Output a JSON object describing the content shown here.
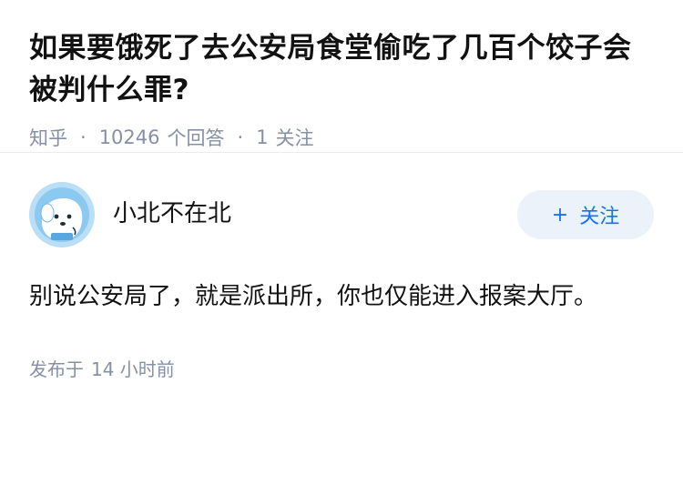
{
  "question": {
    "title": "如果要饿死了去公安局食堂偷吃了几百个饺子会被判什么罪?",
    "source": "知乎",
    "answer_count": "10246",
    "answer_label": "个回答",
    "follower_count": "1",
    "follower_label": "关注"
  },
  "answer": {
    "author_name": "小北不在北",
    "follow_button": {
      "plus": "+",
      "label": "关注"
    },
    "content": "别说公安局了，就是派出所，你也仅能进入报案大厅。",
    "published_label": "发布于",
    "published_time": "14 小时前"
  },
  "colors": {
    "accent": "#1772f6",
    "follow_bg": "#ebf2fa",
    "meta_gray": "#8590a6",
    "text": "#121212"
  }
}
